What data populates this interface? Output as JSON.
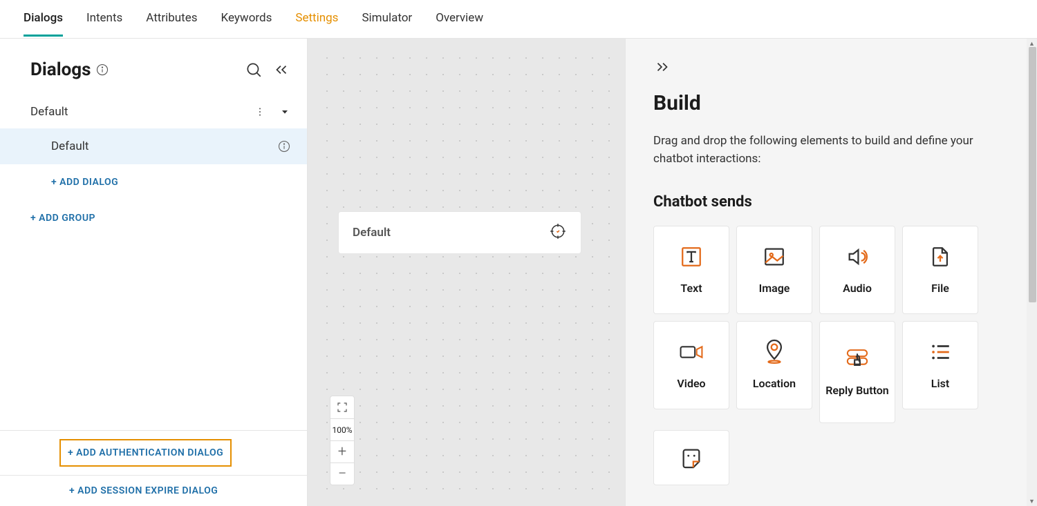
{
  "nav": {
    "tabs": [
      "Dialogs",
      "Intents",
      "Attributes",
      "Keywords",
      "Settings",
      "Simulator",
      "Overview"
    ],
    "active_index": 0,
    "highlight_index": 4
  },
  "sidebar": {
    "title": "Dialogs",
    "group_name": "Default",
    "dialog_name": "Default",
    "add_dialog_label": "+ ADD DIALOG",
    "add_group_label": "+ ADD GROUP",
    "add_auth_label": "+ ADD AUTHENTICATION DIALOG",
    "add_expire_label": "+ ADD SESSION EXPIRE DIALOG"
  },
  "canvas": {
    "card_title": "Default",
    "zoom_label": "100%"
  },
  "build": {
    "title": "Build",
    "description": "Drag and drop the following elements to build and define your chatbot interactions:",
    "section_title": "Chatbot sends",
    "tiles": {
      "text": "Text",
      "image": "Image",
      "audio": "Audio",
      "file": "File",
      "video": "Video",
      "location": "Location",
      "reply_button": "Reply Button",
      "list": "List"
    }
  }
}
